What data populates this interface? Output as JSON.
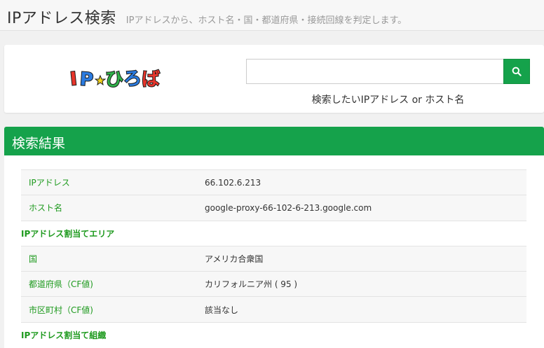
{
  "header": {
    "title": "IPアドレス検索",
    "description": "IPアドレスから、ホスト名・国・都道府県・接続回線を判定します。"
  },
  "logo": {
    "text": "IPひろば"
  },
  "search": {
    "value": "",
    "placeholder": "",
    "button_icon": "search-icon",
    "hint": "検索したいIPアドレス or ホスト名"
  },
  "results": {
    "title": "検索結果",
    "rows": [
      {
        "type": "row",
        "key": "IPアドレス",
        "value": "66.102.6.213"
      },
      {
        "type": "row",
        "key": "ホスト名",
        "value": "google-proxy-66-102-6-213.google.com"
      },
      {
        "type": "section",
        "key": "IPアドレス割当てエリア"
      },
      {
        "type": "row",
        "key": "国",
        "value": "アメリカ合衆国"
      },
      {
        "type": "row",
        "key": "都道府県（CF値)",
        "value": "カリフォルニア州 ( 95 )"
      },
      {
        "type": "row",
        "key": "市区町村（CF値)",
        "value": "該当なし"
      },
      {
        "type": "section",
        "key": "IPアドレス割当て組織"
      }
    ]
  },
  "colors": {
    "accent": "#15a24b",
    "label": "#1e9a1e"
  }
}
